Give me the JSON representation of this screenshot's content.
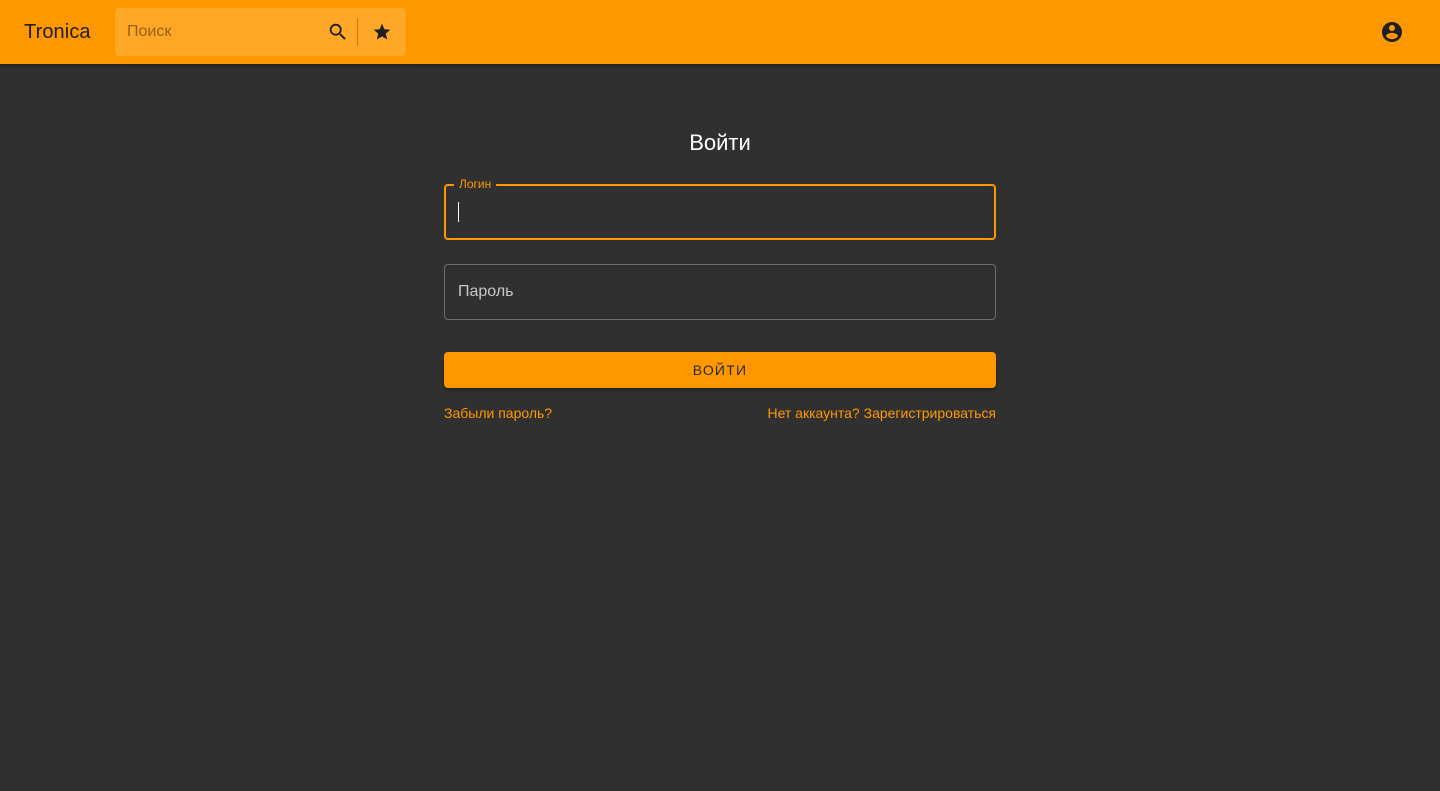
{
  "app": {
    "title": "Tronica"
  },
  "header": {
    "search_placeholder": "Поиск",
    "icons": {
      "search": "search-icon",
      "favorites": "star-icon",
      "account": "account-circle-icon"
    }
  },
  "login": {
    "title": "Войти",
    "login_label": "Логин",
    "login_value": "",
    "password_placeholder": "Пароль",
    "submit_label": "ВОЙТИ",
    "forgot_link": "Забыли пароль?",
    "register_link": "Нет аккаунта? Зарегистрироваться"
  },
  "colors": {
    "accent": "#ff9800",
    "background": "#303030"
  }
}
